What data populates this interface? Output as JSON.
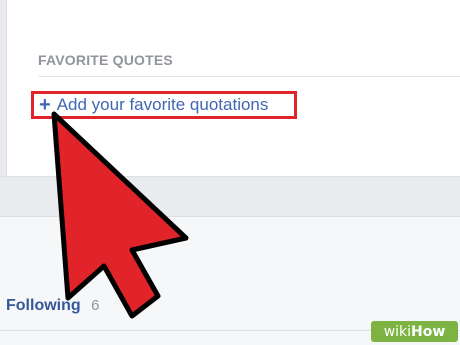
{
  "favorites": {
    "section_title": "FAVORITE QUOTES",
    "add_link_icon": "plus-icon",
    "add_link_label": "Add your favorite quotations"
  },
  "following": {
    "label": "Following",
    "count": "6"
  },
  "overlay": {
    "cursor_icon": "arrow-cursor-icon",
    "highlight_color": "#e0242a",
    "cursor_color": "#e0242a"
  },
  "watermark": {
    "part1": "wiki",
    "part2": "How",
    "color": "#7cb342"
  },
  "colors": {
    "link": "#4267b2",
    "muted": "#90949c"
  }
}
